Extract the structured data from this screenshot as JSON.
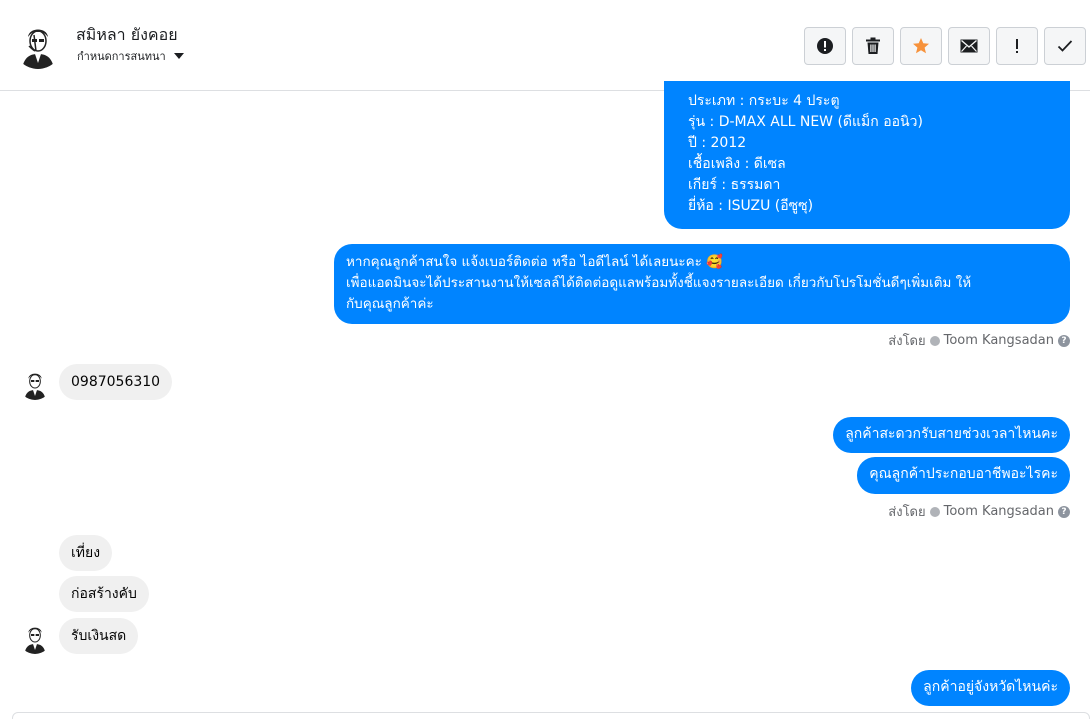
{
  "header": {
    "contact_name": "สมิหลา ยังคอย",
    "assign_label": "กำหนดการสนทนา",
    "avatar_icon": "portrait-avatar-icon",
    "actions": [
      {
        "name": "spam-button",
        "icon": "exclamation-circle-icon"
      },
      {
        "name": "delete-button",
        "icon": "trash-icon"
      },
      {
        "name": "star-button",
        "icon": "star-icon",
        "color": "#f7923b"
      },
      {
        "name": "mark-unread-button",
        "icon": "envelope-icon"
      },
      {
        "name": "flag-button",
        "icon": "exclamation-icon"
      },
      {
        "name": "done-button",
        "icon": "check-icon"
      }
    ]
  },
  "messages": {
    "car_details": [
      "ประเภท : กระบะ 4 ประตู",
      "รุ่น : D-MAX ALL NEW (ดีแม็ก ออนิว)",
      "ปี : 2012",
      "เชื้อเพลิง : ดีเซล",
      "เกียร์ : ธรรมดา",
      "ยี่ห้อ : ISUZU (อีซูซุ)"
    ],
    "contact_request": [
      "หากคุณลูกค้าสนใจ แจ้งเบอร์ติดต่อ หรือ ไอดีไลน์ ได้เลยนะคะ 🥰",
      "เพื่อแอดมินจะได้ประสานงานให้เซลล์ได้ติดต่อดูแลพร้อมทั้งชี้แจงรายละเอียด เกี่ยวกับโปรโมชั่นดีๆเพิ่มเติม ให้",
      "กับคุณลูกค้าค่ะ"
    ],
    "sent_by_prefix": "ส่งโดย",
    "sent_by_name": "Toom Kangsadan",
    "customer_phone": "0987056310",
    "ask_time": "ลูกค้าสะดวกรับสายช่วงเวลาไหนคะ",
    "ask_job": "คุณลูกค้าประกอบอาชีพอะไรคะ",
    "reply_time": "เที่ยง",
    "reply_job": "ก่อสร้างคับ",
    "reply_salary": "รับเงินสด",
    "ask_province": "ลูกค้าอยู่จังหวัดไหนค่ะ"
  },
  "colors": {
    "outgoing_bubble": "#0084ff",
    "incoming_bubble": "#f0f0f0",
    "star": "#f7923b"
  }
}
